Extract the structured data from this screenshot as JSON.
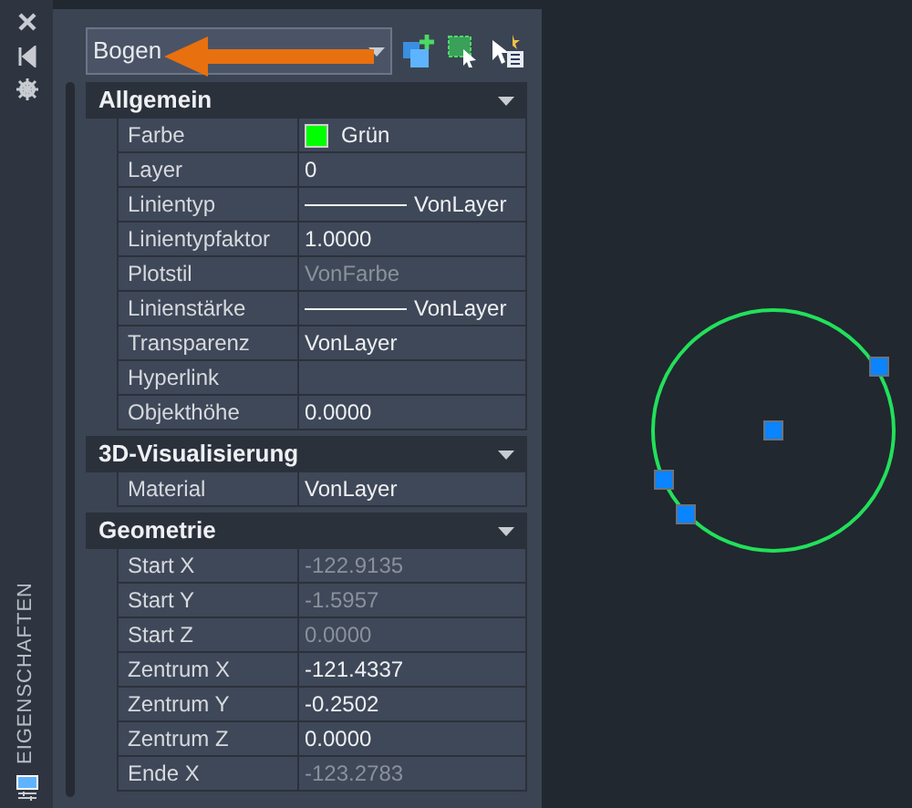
{
  "side_strip": {
    "title": "EIGENSCHAFTEN"
  },
  "object_type": {
    "value": "Bogen"
  },
  "sections": [
    {
      "title": "Allgemein",
      "expanded": true,
      "rows": [
        {
          "label": "Farbe",
          "value": "Grün",
          "kind": "color",
          "color": "#00ff00",
          "readonly": false
        },
        {
          "label": "Layer",
          "value": "0",
          "kind": "text",
          "readonly": false
        },
        {
          "label": "Linientyp",
          "value": "VonLayer",
          "kind": "line",
          "readonly": false
        },
        {
          "label": "Linientypfaktor",
          "value": "1.0000",
          "kind": "text",
          "readonly": false
        },
        {
          "label": "Plotstil",
          "value": "VonFarbe",
          "kind": "text",
          "readonly": true
        },
        {
          "label": "Linienstärke",
          "value": "VonLayer",
          "kind": "line",
          "readonly": false
        },
        {
          "label": "Transparenz",
          "value": "VonLayer",
          "kind": "text",
          "readonly": false
        },
        {
          "label": "Hyperlink",
          "kind": "text",
          "readonly": false
        },
        {
          "label": "Objekthöhe",
          "value": "0.0000",
          "kind": "text",
          "readonly": false
        }
      ]
    },
    {
      "title": "3D-Visualisierung",
      "expanded": true,
      "rows": [
        {
          "label": "Material",
          "value": "VonLayer",
          "kind": "text",
          "readonly": false
        }
      ]
    },
    {
      "title": "Geometrie",
      "expanded": true,
      "rows": [
        {
          "label": "Start X",
          "value": "-122.9135",
          "kind": "text",
          "readonly": true
        },
        {
          "label": "Start Y",
          "value": "-1.5957",
          "kind": "text",
          "readonly": true
        },
        {
          "label": "Start Z",
          "value": "0.0000",
          "kind": "text",
          "readonly": true
        },
        {
          "label": "Zentrum X",
          "value": "-121.4337",
          "kind": "text",
          "readonly": false
        },
        {
          "label": "Zentrum Y",
          "value": "-0.2502",
          "kind": "text",
          "readonly": false
        },
        {
          "label": "Zentrum Z",
          "value": "0.0000",
          "kind": "text",
          "readonly": false
        },
        {
          "label": "Ende X",
          "value": "-123.2783",
          "kind": "text",
          "readonly": true
        }
      ]
    }
  ]
}
